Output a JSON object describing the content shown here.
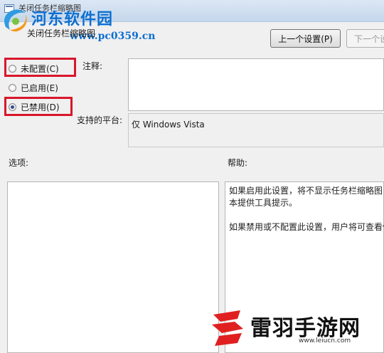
{
  "window": {
    "title": "关闭任务栏缩略图"
  },
  "header": {
    "setting_name": "关闭任务栏缩略图"
  },
  "nav": {
    "previous_label": "上一个设置(P)",
    "next_label": "下一个设"
  },
  "options": {
    "not_configured": "未配置(C)",
    "enabled": "已启用(E)",
    "disabled": "已禁用(D)",
    "selected": "disabled"
  },
  "comment": {
    "label": "注释:",
    "value": ""
  },
  "platform": {
    "label": "支持的平台:",
    "value": "仅 Windows Vista"
  },
  "sections": {
    "options_label": "选项:",
    "help_label": "帮助:"
  },
  "help": {
    "lines": [
      "如果启用此设置，将不显示任务栏缩略图",
      "本提供工具提示。",
      "",
      "如果禁用或不配置此设置，用户将可查看任"
    ]
  },
  "watermarks": {
    "top_title": "河东软件园",
    "top_url": "www.pc0359.cn",
    "bottom_title": "雷羽手游网",
    "bottom_url": "www.leiucn.com"
  },
  "colors": {
    "highlight_box": "#d9172b",
    "watermark_blue": "#0d6fd0"
  }
}
